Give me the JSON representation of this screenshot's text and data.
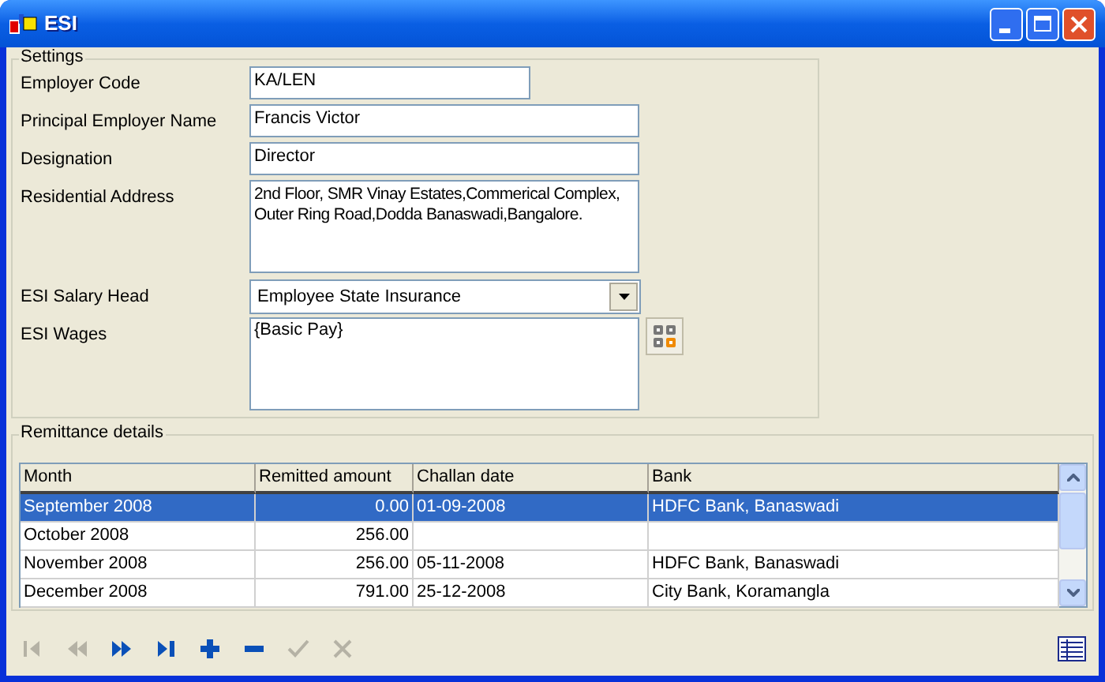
{
  "window": {
    "title": "ESI"
  },
  "settings": {
    "title": "Settings",
    "fields": [
      {
        "kind": "text",
        "label": "Employer Code",
        "value": "KA/LEN"
      },
      {
        "kind": "text",
        "label": "Principal Employer Name",
        "value": "Francis Victor"
      },
      {
        "kind": "text",
        "label": "Designation",
        "value": "Director"
      },
      {
        "kind": "textarea",
        "label": "Residential Address",
        "value": "2nd Floor, SMR Vinay Estates,Commerical Complex, Outer Ring Road,Dodda Banaswadi,Bangalore."
      },
      {
        "kind": "dropdown",
        "label": "ESI Salary Head",
        "value": "Employee State Insurance"
      },
      {
        "kind": "formula",
        "label": "ESI Wages",
        "value": "{Basic Pay}"
      }
    ]
  },
  "remittance": {
    "title": "Remittance details",
    "columns": [
      "Month",
      "Remitted amount",
      "Challan date",
      "Bank"
    ],
    "rows": [
      {
        "selected": true,
        "cells": [
          "September 2008",
          "0.00",
          "01-09-2008",
          "HDFC Bank, Banaswadi"
        ]
      },
      {
        "selected": false,
        "cells": [
          "October 2008",
          "256.00",
          "",
          ""
        ]
      },
      {
        "selected": false,
        "cells": [
          "November 2008",
          "256.00",
          "05-11-2008",
          "HDFC Bank, Banaswadi"
        ]
      },
      {
        "selected": false,
        "cells": [
          "December 2008",
          "791.00",
          "25-12-2008",
          "City Bank, Koramangla"
        ]
      }
    ]
  },
  "toolbar": [
    {
      "kind": "first",
      "disabled": true
    },
    {
      "kind": "prev",
      "disabled": true
    },
    {
      "kind": "next",
      "disabled": false
    },
    {
      "kind": "last",
      "disabled": false
    },
    {
      "kind": "add",
      "disabled": false
    },
    {
      "kind": "remove",
      "disabled": false
    },
    {
      "kind": "save",
      "disabled": true
    },
    {
      "kind": "cancel",
      "disabled": true
    }
  ]
}
